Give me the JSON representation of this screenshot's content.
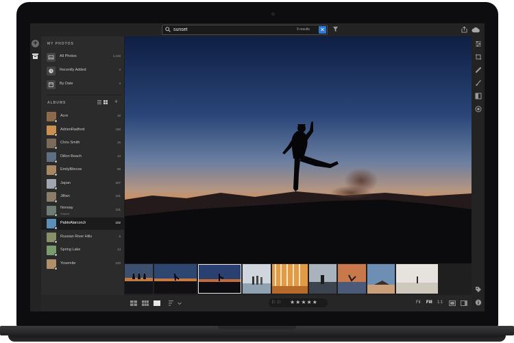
{
  "search": {
    "query": "sunset",
    "results_label": "9 results",
    "clear_label": "✕"
  },
  "rail": {
    "add_label": "+"
  },
  "my_photos": {
    "title": "MY PHOTOS",
    "items": [
      {
        "label": "All Photos",
        "count": "1,133",
        "icon": "photos-icon"
      },
      {
        "label": "Recently Added",
        "count": "4",
        "icon": "clock-icon"
      },
      {
        "label": "By Date",
        "count": "4",
        "icon": "calendar-icon"
      }
    ]
  },
  "albums": {
    "title": "ALBUMS",
    "add_label": "+",
    "items": [
      {
        "label": "Acre",
        "sub": "",
        "count": "19",
        "color": "#8a6a4a"
      },
      {
        "label": "AdrienRadford",
        "sub": "",
        "count": "190",
        "color": "#c9914f"
      },
      {
        "label": "Chris Smith",
        "sub": "",
        "count": "16",
        "color": "#7b6a5a"
      },
      {
        "label": "Dillon Beach",
        "sub": "",
        "count": "13",
        "color": "#5d6f80"
      },
      {
        "label": "EmilyBlincoe",
        "sub": "",
        "count": "99",
        "color": "#a88763"
      },
      {
        "label": "Japan",
        "sub": "",
        "count": "207",
        "color": "#9fa6ad"
      },
      {
        "label": "Jillian",
        "sub": "",
        "count": "101",
        "color": "#8c7d6b"
      },
      {
        "label": "Norway",
        "sub": "Shared",
        "count": "101",
        "color": "#6d7c74"
      },
      {
        "label": "PabloAlarconJr",
        "sub": "",
        "count": "102",
        "color": "#5b8fb8"
      },
      {
        "label": "Russian River Hills",
        "sub": "",
        "count": "5",
        "color": "#88906a"
      },
      {
        "label": "Spring Lake",
        "sub": "",
        "count": "14",
        "color": "#7a9b6e"
      },
      {
        "label": "Yosemite",
        "sub": "",
        "count": "220",
        "color": "#b08f6c"
      }
    ],
    "active_index": 8
  },
  "viewer": {
    "rating_flags": "⚐ ⚐",
    "rating_stars": "★★★★★",
    "zoom_fit": "Fit",
    "zoom_fill": "Fill",
    "zoom_one": "1:1"
  },
  "colors": {
    "accent": "#2d7ad6",
    "background": "#2b2b2b",
    "panel": "#232323"
  }
}
